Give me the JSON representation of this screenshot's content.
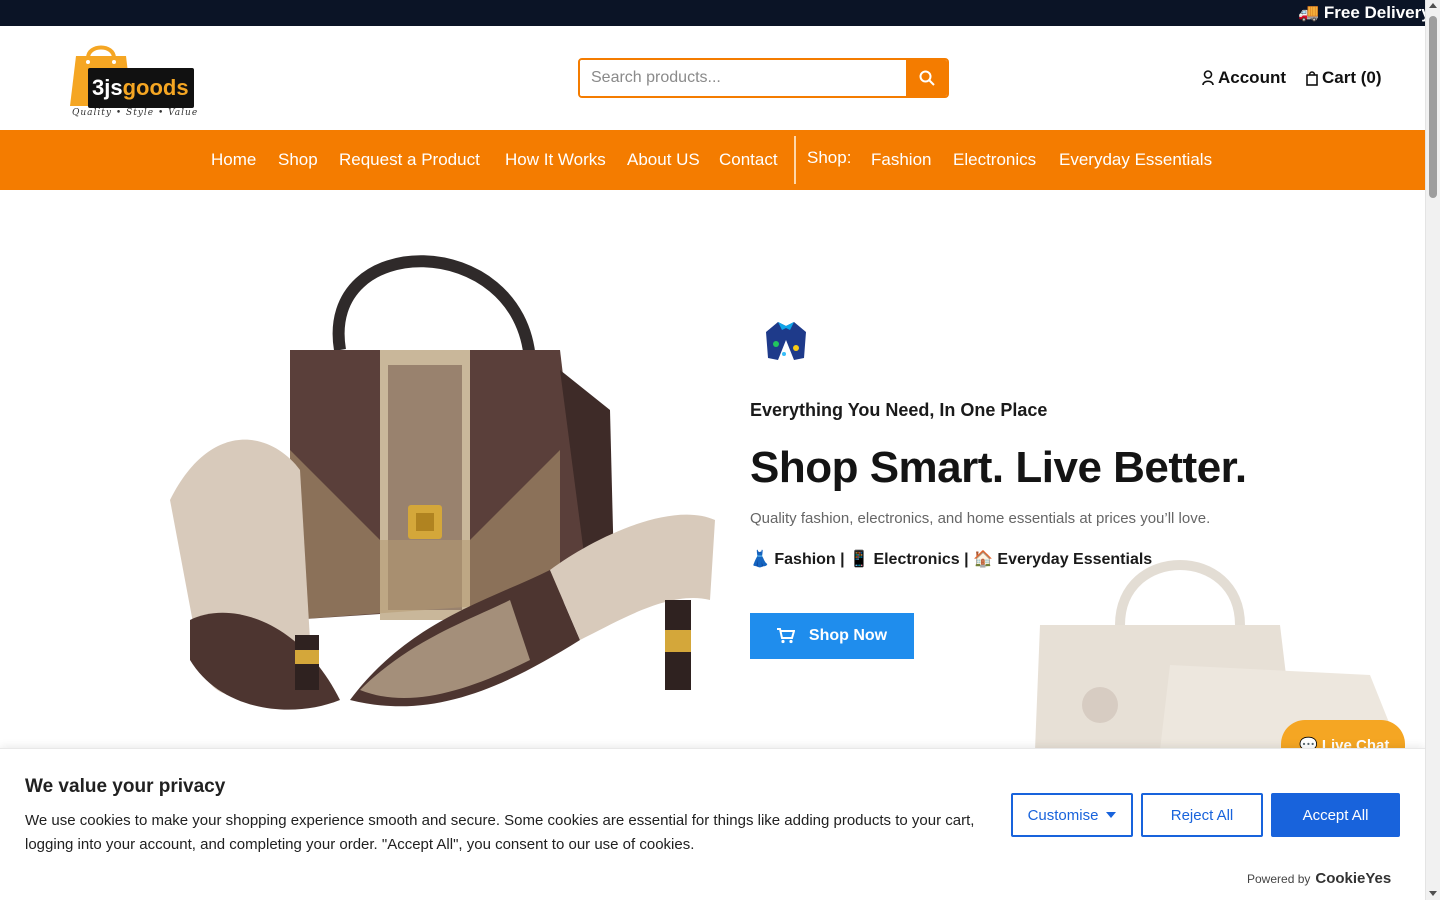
{
  "announcement": {
    "text": "🚚 Free Delivery C"
  },
  "header": {
    "logo": {
      "brand_part1": "3js",
      "brand_part2": "goods",
      "tagline": "Quality • Style • Value"
    },
    "search": {
      "placeholder": "Search products..."
    },
    "account_label": "Account",
    "cart_label": "Cart (0)"
  },
  "nav": {
    "items": [
      "Home",
      "Shop",
      "Request a Product",
      "How It Works",
      "About US",
      "Contact"
    ],
    "shop_label": "Shop:",
    "categories": [
      "Fashion",
      "Electronics",
      "Everyday Essentials"
    ]
  },
  "hero": {
    "eyebrow": "Everything You Need, In One Place",
    "headline": "Shop Smart. Live Better.",
    "subtext": "Quality fashion, electronics, and home essentials at prices you’ll love.",
    "categories_line": "👗 Fashion | 📱 Electronics | 🏠 Everyday Essentials",
    "cta_label": "Shop Now"
  },
  "live_chat": {
    "label": "💬 Live Chat"
  },
  "cookie_banner": {
    "title": "We value your privacy",
    "text": "We use cookies to make your shopping experience smooth and secure. Some cookies are essential for things like adding products to your cart, logging into your account, and completing your order. \"Accept All\", you consent to our use of cookies.",
    "customise_label": "Customise",
    "reject_label": "Reject All",
    "accept_label": "Accept All",
    "powered_by": "Powered by",
    "powered_brand": "CookieYes"
  },
  "colors": {
    "topbar": "#0b1426",
    "brand_orange": "#f47c00",
    "cta_blue": "#1f8ded",
    "cookie_blue": "#1863dc",
    "chat_orange": "#f5a623"
  },
  "icons": {
    "search": "search-icon",
    "account": "user-icon",
    "cart": "cart-icon",
    "cta": "cart-icon",
    "customise": "caret-down-icon"
  }
}
